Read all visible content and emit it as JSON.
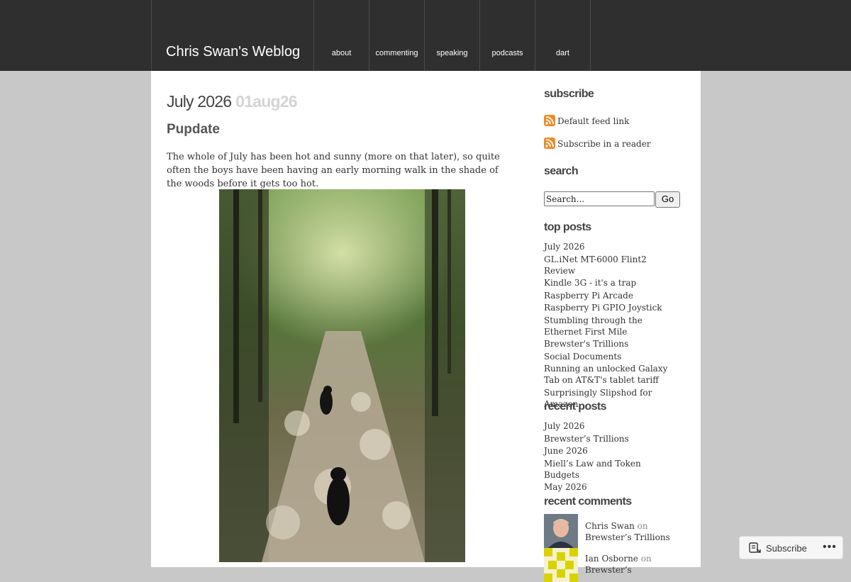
{
  "header": {
    "site_title": "Chris Swan's Weblog",
    "nav": [
      "about",
      "commenting",
      "speaking",
      "podcasts",
      "dart"
    ]
  },
  "post": {
    "title": "July 2026",
    "date": "01aug26",
    "subtitle": "Pupdate",
    "body": "The whole of July has been hot and sunny (more on that later), so quite often the boys have been having an early morning walk in the shade of the woods before it gets too hot."
  },
  "sidebar": {
    "subscribe_heading": "subscribe",
    "feeds": [
      "Default feed link",
      "Subscribe in a reader"
    ],
    "search_heading": "search",
    "search_value": "Search...",
    "go_label": "Go",
    "top_posts_heading": "top posts",
    "top_posts": [
      "July 2026",
      "GL.iNet MT-6000 Flint2 Review",
      "Kindle 3G - it's a trap",
      "Raspberry Pi Arcade",
      "Raspberry Pi GPIO Joystick",
      "Stumbling through the Ethernet First Mile",
      "Brewster's Trillions",
      "Social Documents",
      "Running an unlocked Galaxy Tab on AT&T's tablet tariff",
      "Surprisingly Slipshod for Amazon"
    ],
    "recent_posts_heading": "recent posts",
    "recent_posts": [
      "July 2026",
      "Brewster’s Trillions",
      "June 2026",
      "Miell’s Law and Token Budgets",
      "May 2026"
    ],
    "recent_comments_heading": "recent comments",
    "recent_comments": [
      {
        "author": "Chris Swan",
        "on": "on",
        "post": "Brewster’s Trillions"
      },
      {
        "author": "Ian Osborne",
        "on": "on",
        "post": "Brewster’s"
      }
    ]
  },
  "subscribe_button": {
    "label": "Subscribe",
    "more": "•••"
  },
  "colors": {
    "header_bg": "#2f2f2f",
    "page_bg": "#c8c8c8",
    "rss": "#f08a24"
  },
  "icons": [
    "rss-icon",
    "reader-icon",
    "ellipsis-icon"
  ]
}
